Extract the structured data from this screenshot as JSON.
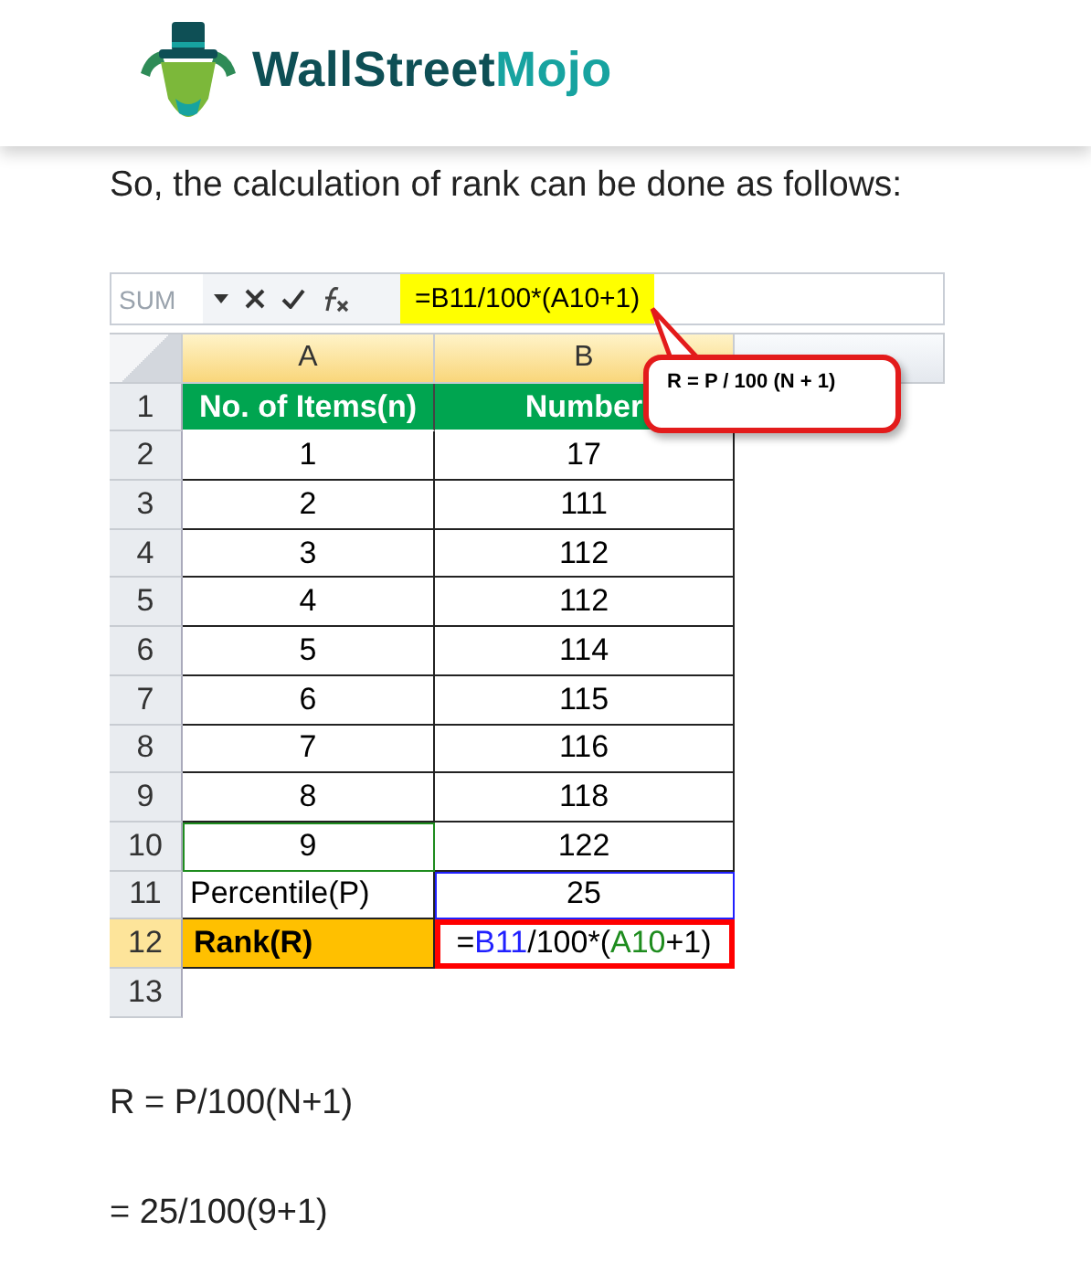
{
  "brand": {
    "name": "WallStreet",
    "accent": "Mojo"
  },
  "intro": "So, the calculation of rank can be done as follows:",
  "spreadsheet": {
    "name_box": "SUM",
    "formula": "=B11/100*(A10+1)",
    "columns": [
      {
        "label": "A",
        "selected": true
      },
      {
        "label": "B",
        "selected": true
      }
    ],
    "rows": [
      {
        "number": "1",
        "selected": false,
        "cells": [
          {
            "kind": "header",
            "text": "No. of Items(n)"
          },
          {
            "kind": "header",
            "text": "Number"
          }
        ]
      },
      {
        "number": "2",
        "selected": false,
        "cells": [
          {
            "kind": "value",
            "text": "1"
          },
          {
            "kind": "value",
            "text": "17"
          }
        ]
      },
      {
        "number": "3",
        "selected": false,
        "cells": [
          {
            "kind": "value",
            "text": "2"
          },
          {
            "kind": "value",
            "text": "111"
          }
        ]
      },
      {
        "number": "4",
        "selected": false,
        "cells": [
          {
            "kind": "value",
            "text": "3"
          },
          {
            "kind": "value",
            "text": "112"
          }
        ]
      },
      {
        "number": "5",
        "selected": false,
        "cells": [
          {
            "kind": "value",
            "text": "4"
          },
          {
            "kind": "value",
            "text": "112"
          }
        ]
      },
      {
        "number": "6",
        "selected": false,
        "cells": [
          {
            "kind": "value",
            "text": "5"
          },
          {
            "kind": "value",
            "text": "114"
          }
        ]
      },
      {
        "number": "7",
        "selected": false,
        "cells": [
          {
            "kind": "value",
            "text": "6"
          },
          {
            "kind": "value",
            "text": "115"
          }
        ]
      },
      {
        "number": "8",
        "selected": false,
        "cells": [
          {
            "kind": "value",
            "text": "7"
          },
          {
            "kind": "value",
            "text": "116"
          }
        ]
      },
      {
        "number": "9",
        "selected": false,
        "cells": [
          {
            "kind": "value",
            "text": "8"
          },
          {
            "kind": "value",
            "text": "118"
          }
        ]
      },
      {
        "number": "10",
        "selected": false,
        "cells": [
          {
            "kind": "value",
            "text": "9",
            "color": "#1e8c1e"
          },
          {
            "kind": "value",
            "text": "122"
          }
        ]
      },
      {
        "number": "11",
        "selected": false,
        "cells": [
          {
            "kind": "label",
            "text": "Percentile(P)"
          },
          {
            "kind": "value",
            "text": "25",
            "color": "#2020ff"
          }
        ]
      },
      {
        "number": "12",
        "selected": true,
        "cells": [
          {
            "kind": "rank",
            "text": "Rank(R)"
          },
          {
            "kind": "formula",
            "color": "#ff0000",
            "parts": [
              {
                "text": "=",
                "color": "#000000"
              },
              {
                "text": "B11",
                "color": "#2020ff"
              },
              {
                "text": "/100*(",
                "color": "#000000"
              },
              {
                "text": "A10",
                "color": "#1e8c1e"
              },
              {
                "text": "+1)",
                "color": "#000000"
              }
            ]
          }
        ]
      },
      {
        "number": "13",
        "selected": false,
        "cells": [
          {
            "kind": "empty"
          },
          {
            "kind": "empty"
          }
        ]
      }
    ],
    "callout": "R = P / 100 (N + 1)"
  },
  "equations": [
    "R = P/100(N+1)",
    "= 25/100(9+1)"
  ]
}
